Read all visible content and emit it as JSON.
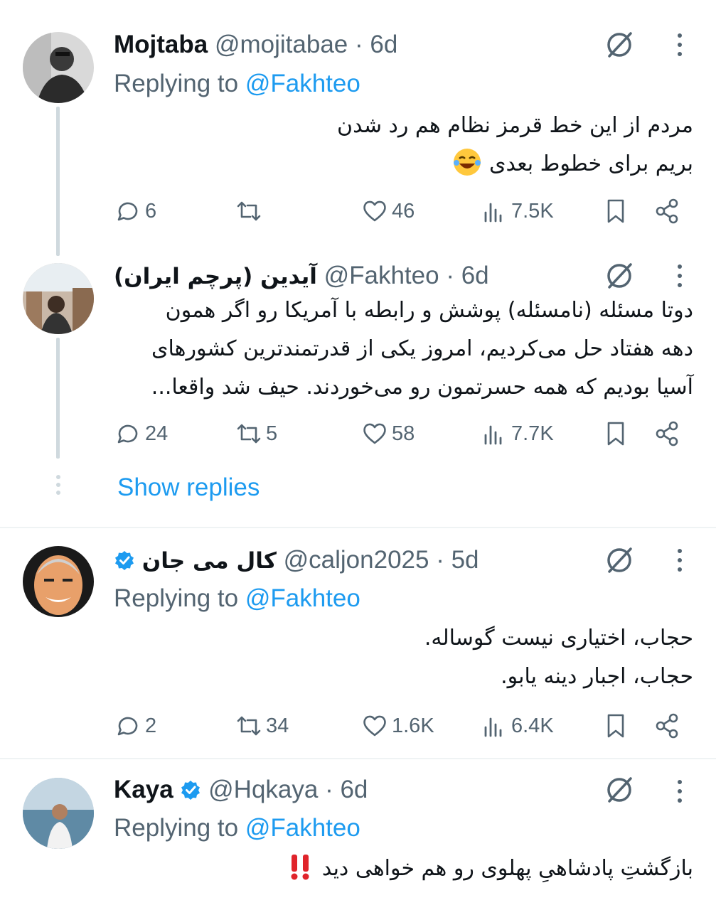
{
  "tweets": [
    {
      "name": "Mojtaba",
      "handle": "@mojitabae",
      "dot": "·",
      "time": "6d",
      "replying_prefix": "Replying to ",
      "replying_to": "@Fakhteo",
      "lines": [
        "مردم از این خط قرمز نظام هم رد شدن",
        "بریم برای خطوط بعدی"
      ],
      "replies": "6",
      "retweets": "",
      "likes": "46",
      "views": "7.5K"
    },
    {
      "name": "آیدین (پرچم ایران)",
      "handle": "@Fakhteo",
      "dot": "·",
      "time": "6d",
      "lines": [
        "دوتا مسئله (نامسئله) پوشش و رابطه با آمریکا رو اگر همون",
        "دهه هفتاد حل می‌کردیم، امروز یکی از قدرتمندترین کشورهای",
        "آسیا بودیم که همه حسرتمون رو می‌خوردند. حیف شد واقعا..."
      ],
      "replies": "24",
      "retweets": "5",
      "likes": "58",
      "views": "7.7K",
      "show_replies": "Show replies"
    },
    {
      "name": "کال می جان",
      "handle": "@caljon2025",
      "dot": "·",
      "time": "5d",
      "replying_prefix": "Replying to ",
      "replying_to": "@Fakhteo",
      "lines": [
        "حجاب، اختیاری نیست گوساله.",
        "حجاب، اجبار دینه یابو."
      ],
      "replies": "2",
      "retweets": "34",
      "likes": "1.6K",
      "views": "6.4K"
    },
    {
      "name": "Kaya",
      "handle": "@Hqkaya",
      "dot": "·",
      "time": "6d",
      "replying_prefix": "Replying to ",
      "replying_to": "@Fakhteo",
      "lines": [
        "بازگشتِ پادشاهیِ پهلوی رو هم خواهی دید"
      ]
    }
  ],
  "colors": {
    "primary_text": "#0f1419",
    "secondary_text": "#536471",
    "link": "#1d9bf0",
    "thread_line": "#cfd9de",
    "verified": "#1d9bf0"
  },
  "icons": [
    "grok-icon",
    "more-icon",
    "reply-icon",
    "retweet-icon",
    "like-icon",
    "views-icon",
    "bookmark-icon",
    "share-icon",
    "verified-icon",
    "laughing-emoji",
    "double-exclamation-emoji"
  ]
}
